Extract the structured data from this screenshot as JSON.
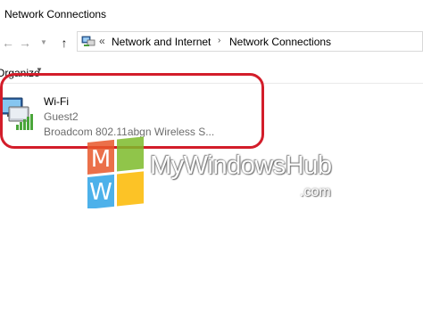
{
  "window": {
    "title": "Network Connections"
  },
  "navigation": {
    "back_icon": "back-arrow-icon",
    "forward_icon": "forward-arrow-icon",
    "recent_icon": "chevron-down-icon",
    "up_icon": "up-arrow-icon",
    "breadcrumb_overflow": "«",
    "breadcrumbs": [
      "Network and Internet",
      "Network Connections"
    ]
  },
  "toolbar": {
    "organize_label": "Organize",
    "organize_icon": "chevron-down-icon"
  },
  "adapter": {
    "name": "Wi-Fi",
    "ssid": "Guest2",
    "device": "Broadcom 802.11abgn Wireless S...",
    "icon": "wifi-adapter-icon"
  },
  "annotation": {
    "highlight_color": "#d31d2a"
  },
  "watermark": {
    "logo_letters": [
      "M",
      "W"
    ],
    "name": "MyWindowsHub",
    "suffix": ".com",
    "tile_colors": [
      "#e8572a",
      "#7cbb2a",
      "#2ea3e6",
      "#fbb800"
    ]
  }
}
